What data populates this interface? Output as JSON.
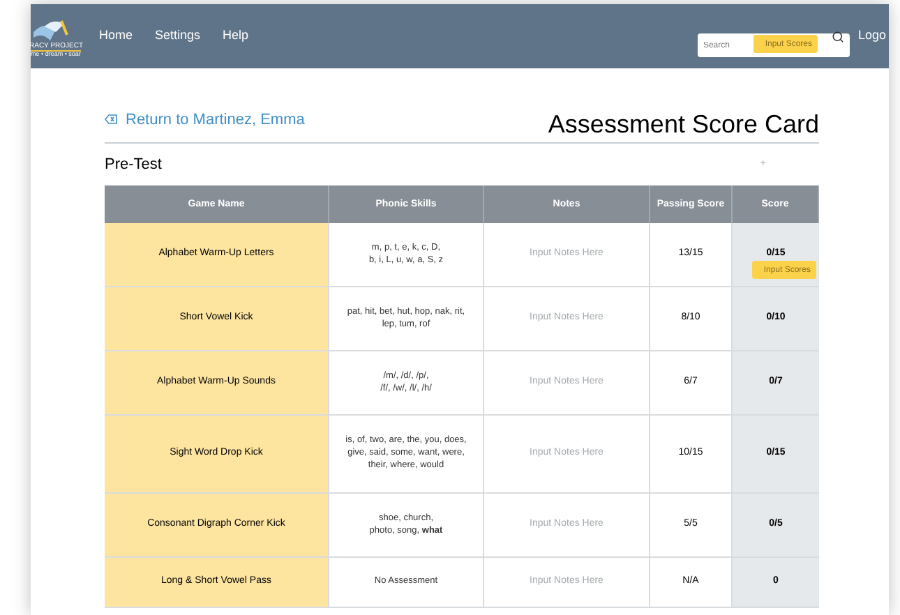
{
  "logo": {
    "name": "RACY PROJECT",
    "tagline": "me • dream • soar"
  },
  "nav": [
    {
      "label": "Home"
    },
    {
      "label": "Settings"
    },
    {
      "label": "Help"
    }
  ],
  "search": {
    "placeholder": "Search"
  },
  "header_tooltip": "Input Scores",
  "logout": "Logo",
  "back_link": "Return to Martinez, Emma",
  "title": "Assessment Score Card",
  "section": {
    "title": "Pre-Test",
    "add": "+"
  },
  "table": {
    "columns": [
      "Game Name",
      "Phonic Skills",
      "Notes",
      "Passing Score",
      "Score"
    ],
    "rows": [
      {
        "game": "Alphabet Warm-Up Letters",
        "skills": "m, p, t, e, k, c, D,\nb, i, L, u, w, a, S, z",
        "notes_placeholder": "Input Notes Here",
        "passing": "13/15",
        "score": "0/15",
        "tooltip": "Input Scores"
      },
      {
        "game": "Short Vowel Kick",
        "skills": "pat, hit, bet, hut, hop, nak, rit,\nlep, tum, rof",
        "notes_placeholder": "Input Notes Here",
        "passing": "8/10",
        "score": "0/10"
      },
      {
        "game": "Alphabet Warm-Up Sounds",
        "skills": "/m/, /d/, /p/,\n/f/, /w/, /l/, /h/",
        "notes_placeholder": "Input Notes Here",
        "passing": "6/7",
        "score": "0/7"
      },
      {
        "game": "Sight Word Drop Kick",
        "skills": "is, of, two, are, the, you, does,\ngive, said, some, want, were,\ntheir, where, would",
        "notes_placeholder": "Input Notes Here",
        "passing": "10/15",
        "score": "0/15"
      },
      {
        "game": "Consonant Digraph Corner Kick",
        "skills": "shoe, church,\nphoto, song, **what**",
        "notes_placeholder": "Input Notes Here",
        "passing": "5/5",
        "score": "0/5"
      },
      {
        "game": "Long & Short Vowel Pass",
        "skills": "No Assessment",
        "notes_placeholder": "Input Notes Here",
        "passing": "N/A",
        "score": "0"
      }
    ]
  }
}
